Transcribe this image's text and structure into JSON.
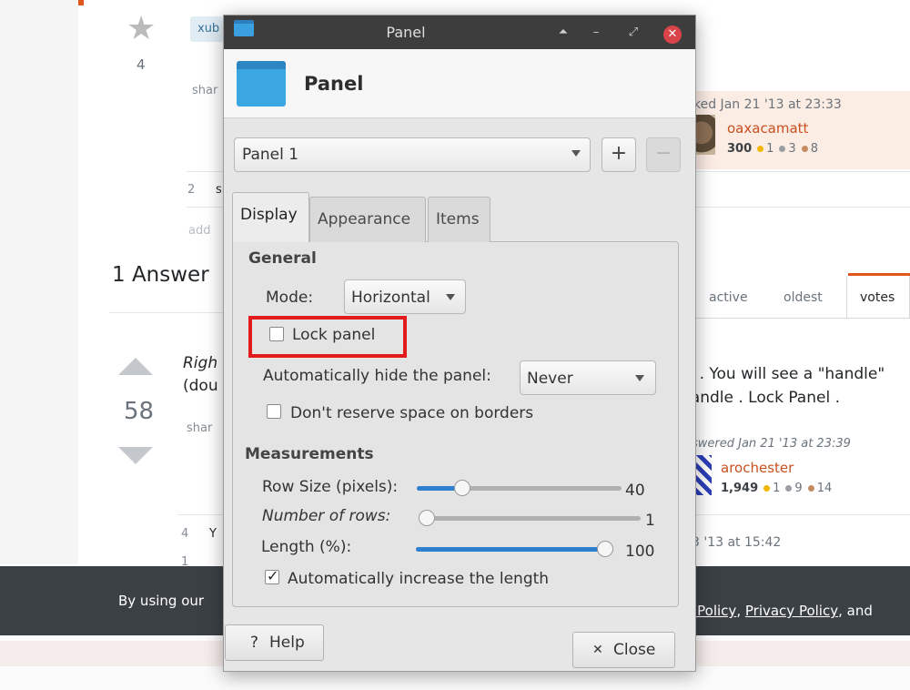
{
  "background": {
    "question_votes": "4",
    "tag_visible": "xub",
    "share_truncated_top": "shar",
    "comment_count": "2",
    "comment_initial": "s",
    "add_truncated": "add",
    "answers_heading": "1 Answer",
    "answer_votes": "58",
    "answer_line1_start": "Righ",
    "answer_line2_start": "(dou",
    "answer_line1_end": "el . You will see a \"handle\"",
    "answer_line2_end": "handle . Lock Panel .",
    "share_truncated_answer": "shar",
    "answer_comment_count": "4",
    "answer_comment_initial": "Y",
    "answer_comment_count2": "1",
    "asked_meta": "ked Jan 21 '13 at 23:33",
    "asked_user": "oaxacamatt",
    "asked_rep": "300",
    "asked_gold": "1",
    "asked_silver": "3",
    "asked_bronze": "8",
    "sort_tabs": [
      "active",
      "oldest",
      "votes"
    ],
    "answered_meta": "swered Jan 21 '13 at 23:39",
    "answered_user": "arochester",
    "answered_rep": "1,949",
    "answered_gold": "1",
    "answered_silver": "9",
    "answered_bronze": "14",
    "edited_meta": "3 '13 at 15:42",
    "cookie_prefix": "By using our",
    "cookie_link1": "ie Policy",
    "cookie_sep1": ",",
    "cookie_link2": "Privacy Policy",
    "cookie_suffix": ", and"
  },
  "dialog": {
    "window_title": "Panel",
    "titlebar_buttons": {
      "shade": "⏶",
      "minimize": "–",
      "maximize": "⤢",
      "close": "✕"
    },
    "header_title": "Panel",
    "panel_selector": {
      "value": "Panel 1"
    },
    "add_button": "+",
    "remove_button": "−",
    "tabs": [
      "Display",
      "Appearance",
      "Items"
    ],
    "active_tab": "Display",
    "general": {
      "heading": "General",
      "mode_label": "Mode:",
      "mode_value": "Horizontal",
      "lock_panel_label": "Lock panel",
      "lock_panel_checked": false,
      "autohide_label": "Automatically hide the panel:",
      "autohide_value": "Never",
      "reserve_label": "Don't reserve space on borders",
      "reserve_checked": false
    },
    "measurements": {
      "heading": "Measurements",
      "row_size_label": "Row Size (pixels):",
      "row_size_value": "40",
      "row_size_fraction": 0.2,
      "rows_label": "Number of rows:",
      "rows_value": "1",
      "rows_fraction": 0.0,
      "length_label": "Length (%):",
      "length_value": "100",
      "length_fraction": 1.0,
      "auto_increase_label": "Automatically increase the length",
      "auto_increase_checked": true
    },
    "help_button": {
      "glyph": "?",
      "label": "Help"
    },
    "close_button": {
      "glyph": "✕",
      "label": "Close"
    },
    "colors": {
      "highlight_box": "#e41b1b",
      "slider_fill": "#2f7fd0",
      "folder_icon": "#3aa6e2"
    }
  }
}
